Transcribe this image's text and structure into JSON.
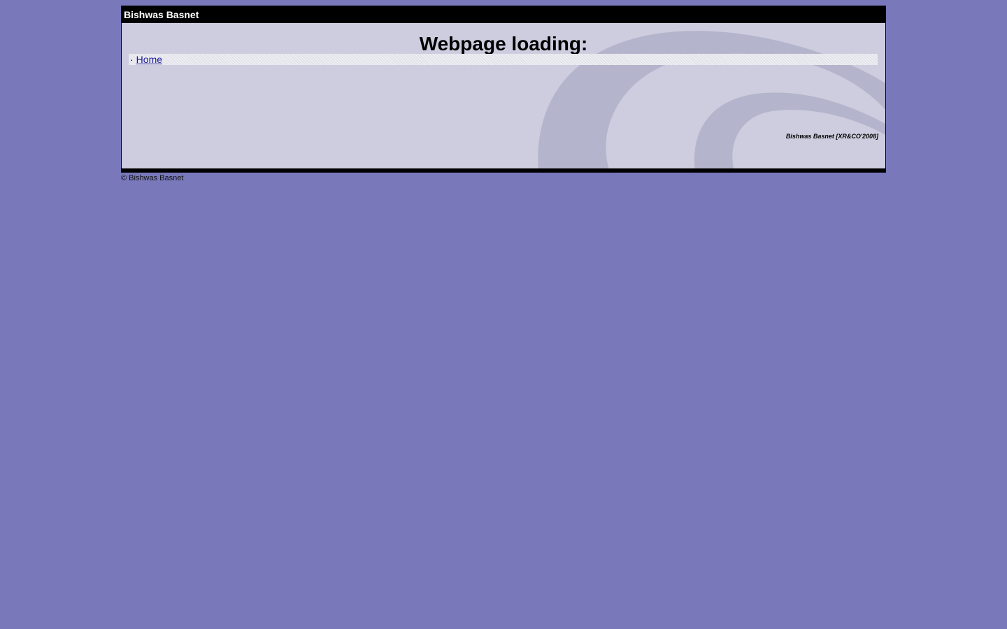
{
  "header": {
    "title": "Bishwas Basnet"
  },
  "main": {
    "heading": "Webpage loading:",
    "nav": {
      "bullet": "·",
      "items": [
        {
          "label": "Home"
        }
      ]
    },
    "credit": "Bishwas Basnet [XR&CO'2008]"
  },
  "footer": {
    "copyright": "© Bishwas Basnet"
  },
  "colors": {
    "page_background": "#7878bb",
    "content_background": "#cdcddf",
    "swirl": "#b4b4cc",
    "bars": "#000000",
    "link": "#1a1a99"
  }
}
